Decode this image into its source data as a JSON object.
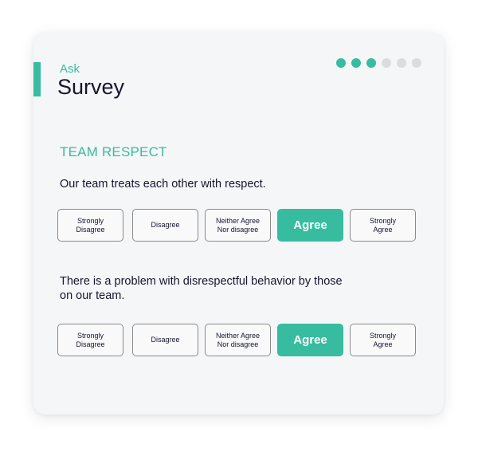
{
  "header": {
    "eyebrow": "Ask",
    "title": "Survey"
  },
  "progress": {
    "total_steps": 6,
    "completed_steps": 3,
    "active_color": "#37bc9f",
    "inactive_color": "#dcdcdc"
  },
  "section": {
    "title": "TEAM RESPECT"
  },
  "questions": [
    {
      "text": "Our team treats each other with respect.",
      "options": [
        "Strongly\nDisagree",
        "Disagree",
        "Neither Agree\nNor disagree",
        "Agree",
        "Strongly\nAgree"
      ],
      "selected": "Agree"
    },
    {
      "text": "There is a problem with disrespectful behavior by those on our team.",
      "options": [
        "Strongly\nDisagree",
        "Disagree",
        "Neither Agree\nNor disagree",
        "Agree",
        "Strongly\nAgree"
      ],
      "selected": "Agree"
    }
  ],
  "colors": {
    "accent": "#37bc9f",
    "text": "#14162e",
    "card_background": "#f5f6f8"
  }
}
